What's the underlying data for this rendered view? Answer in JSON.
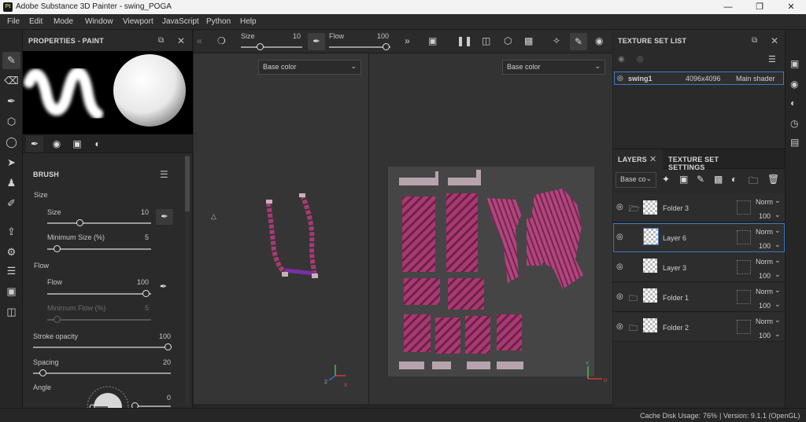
{
  "window": {
    "title": "Adobe Substance 3D Painter - swing_POGA",
    "app_icon_text": "Pt"
  },
  "menu": [
    "File",
    "Edit",
    "Mode",
    "Window",
    "Viewport",
    "JavaScript",
    "Python",
    "Help"
  ],
  "properties": {
    "title": "PROPERTIES - PAINT",
    "brush_section": "BRUSH",
    "size_group": "Size",
    "size_label": "Size",
    "size_value": "10",
    "min_size_label": "Minimum Size (%)",
    "min_size_value": "5",
    "flow_group": "Flow",
    "flow_label": "Flow",
    "flow_value": "100",
    "min_flow_label": "Minimum Flow (%)",
    "min_flow_value": "5",
    "stroke_opacity_label": "Stroke opacity",
    "stroke_opacity_value": "100",
    "spacing_label": "Spacing",
    "spacing_value": "20",
    "angle_label": "Angle",
    "angle_value": "0"
  },
  "toolbar": {
    "size_label": "Size",
    "size_value": "10",
    "flow_label": "Flow",
    "flow_value": "100"
  },
  "viewport": {
    "left_channel": "Base color",
    "right_channel": "Base color"
  },
  "texture_set_list": {
    "title": "TEXTURE SET LIST",
    "items": [
      {
        "name": "swing1",
        "resolution": "4096x4096",
        "shader": "Main shader"
      }
    ]
  },
  "layers_panel": {
    "tab_layers": "LAYERS",
    "tab_settings": "TEXTURE SET SETTINGS",
    "channel_select": "Base co",
    "layers": [
      {
        "name": "Folder 3",
        "blend": "Norm",
        "opacity": "100",
        "type": "folder-open"
      },
      {
        "name": "Layer 6",
        "blend": "Norm",
        "opacity": "100",
        "type": "layer",
        "selected": true
      },
      {
        "name": "Layer 3",
        "blend": "Norm",
        "opacity": "100",
        "type": "layer"
      },
      {
        "name": "Folder 1",
        "blend": "Norm",
        "opacity": "100",
        "type": "folder"
      },
      {
        "name": "Folder 2",
        "blend": "Norm",
        "opacity": "100",
        "type": "folder"
      }
    ]
  },
  "status": {
    "cache_label": "Cache Disk Usage:",
    "cache_value": "76%",
    "version": "| Version: 9.1.1 (OpenGL)"
  },
  "colors": {
    "accent_blue": "#3d78c8",
    "fabric_pink": "#a83a72",
    "viewport_bg": "#353535"
  }
}
